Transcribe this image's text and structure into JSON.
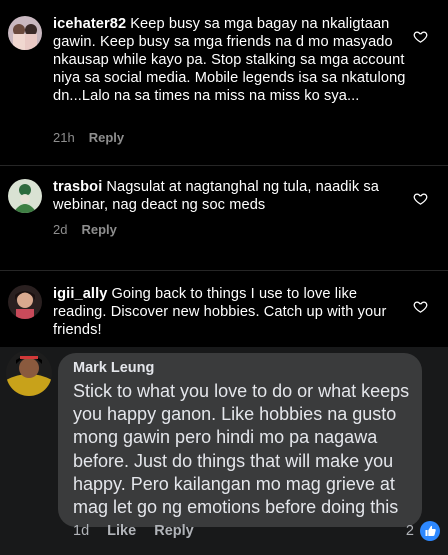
{
  "comments": [
    {
      "username": "icehater82",
      "text": "Keep busy sa mga bagay na nkaligtaan gawin. Keep busy sa mga friends na d mo masyado nkausap while kayo pa. Stop stalking sa mga account niya sa social media. Mobile legends isa sa nkatulong dn...Lalo na sa times na miss na miss ko sya...",
      "time": "21h",
      "reply_label": "Reply"
    },
    {
      "username": "trasboi",
      "text": "Nagsulat at nagtanghal ng tula, naadik sa webinar, nag deact ng soc meds",
      "time": "2d",
      "reply_label": "Reply"
    },
    {
      "username": "igii_ally",
      "text": "Going back to things I use to love like reading. Discover new hobbies. Catch up with your friends!",
      "time": "",
      "reply_label": ""
    }
  ],
  "fb_comment": {
    "name": "Mark Leung",
    "text": "Stick to what you love to do or what keeps you happy ganon. Like hobbies na gusto mong gawin pero hindi mo pa nagawa before. Just do things that will make you happy. Pero kailangan mo mag grieve at mag let go ng emotions before doing this",
    "time": "1d",
    "like_label": "Like",
    "reply_label": "Reply",
    "reaction_count": "2"
  },
  "icons": {
    "heart": "heart-icon",
    "like": "thumbs-up-icon"
  },
  "colors": {
    "ig_bg": "#000000",
    "fb_bg": "#18191a",
    "fb_bubble": "#3a3b3c",
    "meta_gray": "#8e8e8e",
    "fb_blue": "#2d88ff"
  }
}
